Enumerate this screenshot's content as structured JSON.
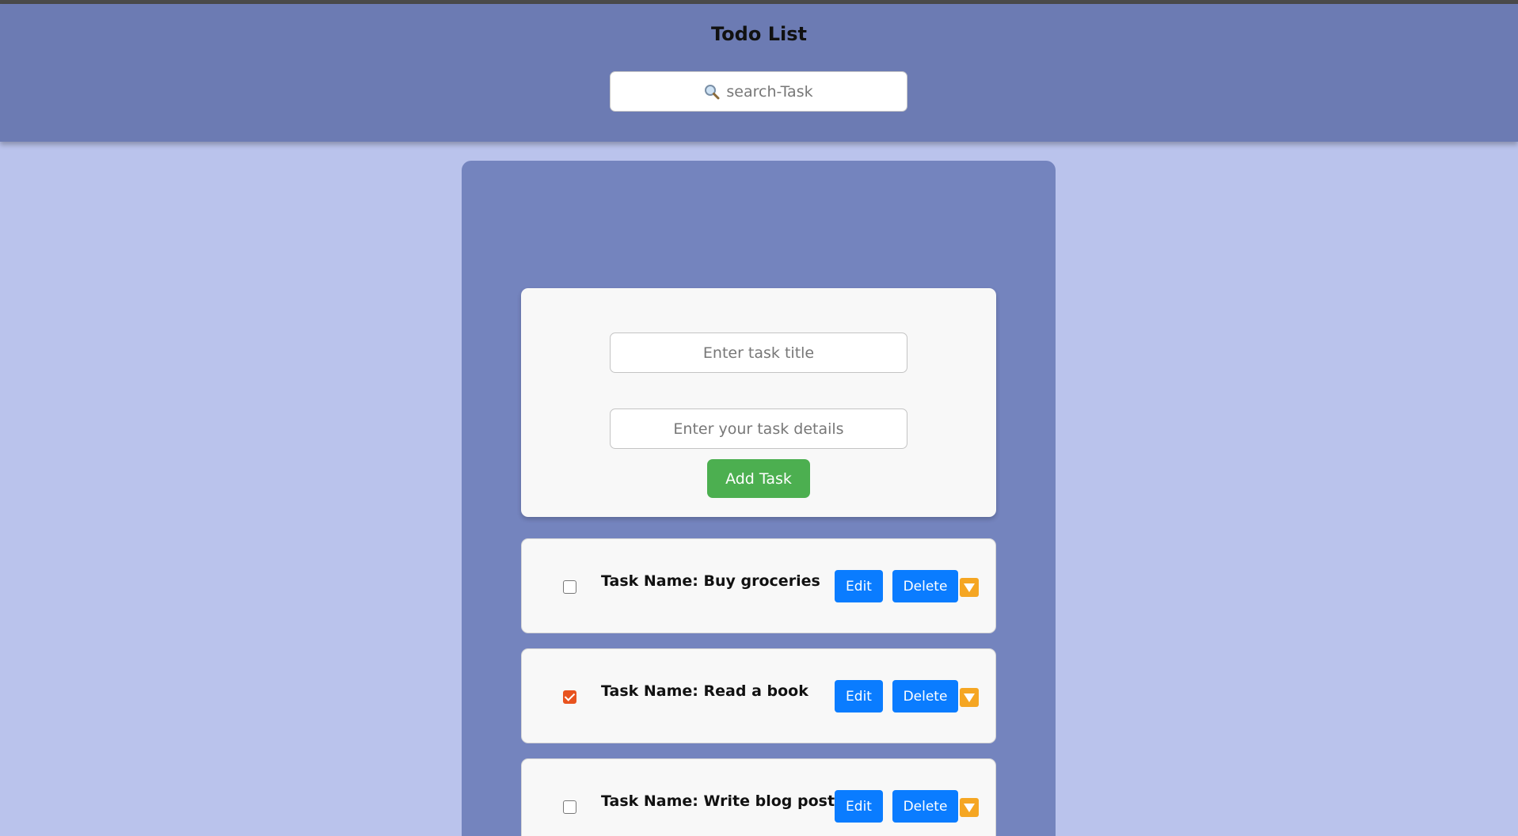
{
  "header": {
    "title": "Todo List",
    "search": {
      "placeholder": "search-Task",
      "icon": "magnifier-icon"
    }
  },
  "form": {
    "title_placeholder": "Enter task title",
    "details_placeholder": "Enter your task details",
    "add_label": "Add Task"
  },
  "tasks": [
    {
      "name": "Task Name: Buy groceries",
      "completed": false,
      "edit_label": "Edit",
      "delete_label": "Delete"
    },
    {
      "name": "Task Name: Read a book",
      "completed": true,
      "edit_label": "Edit",
      "delete_label": "Delete"
    },
    {
      "name": "Task Name: Write blog post",
      "completed": false,
      "edit_label": "Edit",
      "delete_label": "Delete"
    }
  ],
  "colors": {
    "background": "#bac3ec",
    "header": "#6c7bb3",
    "panel": "#7484be",
    "add_button": "#4caf50",
    "action_button": "#0a7cff",
    "expand_button": "#f5a623",
    "checkbox_checked": "#e8531f"
  }
}
